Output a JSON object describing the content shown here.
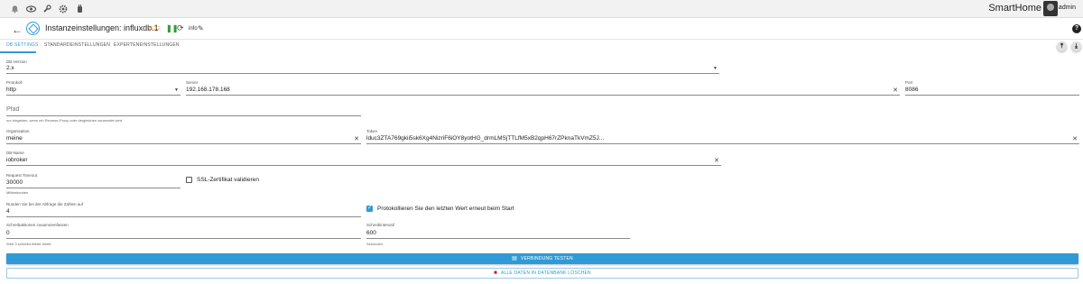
{
  "topbar": {
    "icons": [
      "bell-icon",
      "eye-icon",
      "wrench-icon",
      "gear-icon",
      "hand-icon"
    ],
    "brand": "SmartHome",
    "user": "admin"
  },
  "header": {
    "title": "Instanzeinstellungen: influxdb.1",
    "version": "v4.0.2",
    "log_level": "info"
  },
  "tabs": [
    "DB SETTINGS",
    "STANDARDEINSTELLUNGEN",
    "EXPERTENEINSTELLUNGEN"
  ],
  "form": {
    "db_version": {
      "label": "DB-Version",
      "value": "2.x"
    },
    "protocol": {
      "label": "Protokoll",
      "value": "http"
    },
    "server": {
      "label": "Server",
      "value": "192.168.178.168"
    },
    "port": {
      "label": "Port",
      "value": "8086"
    },
    "path": {
      "placeholder": "Pfad",
      "hint": "nur eingeben, wenn ein Reverse-Proxy oder dergleichen verwendet wird"
    },
    "organization": {
      "label": "Organisation",
      "value": "meine"
    },
    "token": {
      "label": "Token",
      "value": "lduc3ZTA769gkii5sk6Xg4NizriF6iOY8yotHG_drmLMSjTTLfM5xB2qpH67rZPknaTkVmZ5J..."
    },
    "db_name": {
      "label": "DB-Name",
      "value": "iobroker"
    },
    "request_timeout": {
      "label": "Request Timeout",
      "value": "30000",
      "hint": "Millisekunden"
    },
    "ssl_verify": {
      "label": "SSL-Zertifikat validieren",
      "checked": false
    },
    "round": {
      "label": "Runden Sie bei der Abfrage die Zahlen auf",
      "value": "4"
    },
    "log_last": {
      "label": "Protokollieren Sie den letzten Wert erneut beim Start",
      "checked": true
    },
    "batch": {
      "label": "Schreibaktionen zusammenfassen",
      "value": "0",
      "hint": "Wert 0 schreibt Werte direkt"
    },
    "write_interval": {
      "label": "Schreibintervall",
      "value": "600",
      "hint": "Sekunden"
    }
  },
  "buttons": {
    "test": "VERBINDUNG TESTEN",
    "delete": "ALLE DATEN IN DATENBANK LÖSCHEN"
  },
  "colors": {
    "accent": "#2f9bd6",
    "running": "#2e9c3a",
    "version": "#f5a623",
    "danger": "#d0021b"
  }
}
